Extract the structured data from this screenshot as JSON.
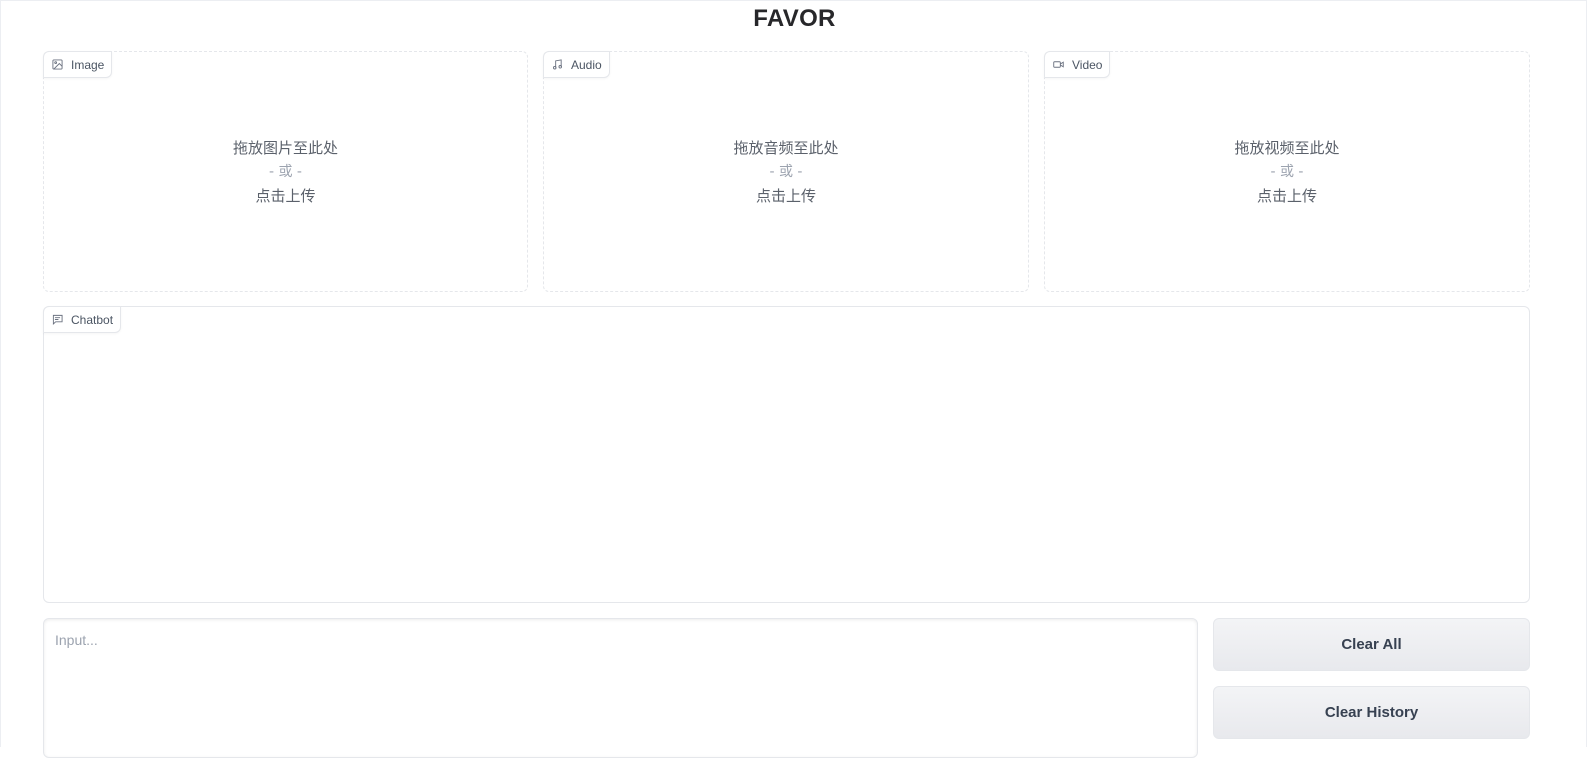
{
  "app": {
    "title": "FAVOR"
  },
  "uploads": [
    {
      "label": "Image",
      "icon": "image-icon",
      "drop_text": "拖放图片至此处",
      "or_text": "- 或 -",
      "click_text": "点击上传"
    },
    {
      "label": "Audio",
      "icon": "music-note-icon",
      "drop_text": "拖放音频至此处",
      "or_text": "- 或 -",
      "click_text": "点击上传"
    },
    {
      "label": "Video",
      "icon": "video-camera-icon",
      "drop_text": "拖放视频至此处",
      "or_text": "- 或 -",
      "click_text": "点击上传"
    }
  ],
  "chatbot": {
    "label": "Chatbot",
    "icon": "chat-icon"
  },
  "input": {
    "placeholder": "Input...",
    "value": ""
  },
  "buttons": {
    "clear_all": "Clear All",
    "clear_history": "Clear History"
  }
}
